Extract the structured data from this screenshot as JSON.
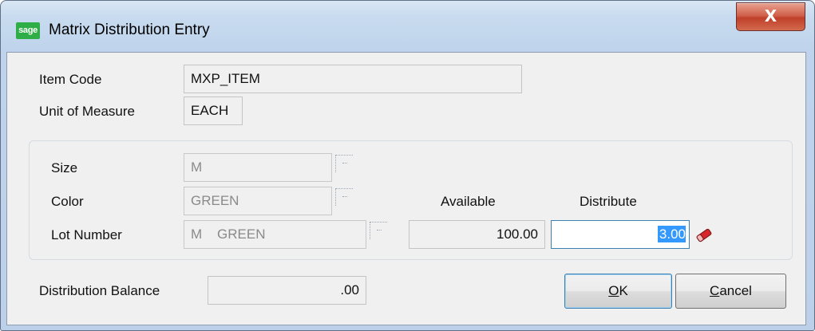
{
  "window": {
    "title": "Matrix Distribution Entry",
    "app_icon_text": "sage",
    "close_label": "X"
  },
  "header_fields": {
    "item_code": {
      "label": "Item Code",
      "value": "MXP_ITEM"
    },
    "unit_of_measure": {
      "label": "Unit of Measure",
      "value": "EACH"
    }
  },
  "matrix": {
    "size": {
      "label": "Size",
      "value": "M"
    },
    "color": {
      "label": "Color",
      "value": "GREEN"
    },
    "lot_number": {
      "label": "Lot Number",
      "value": "M    GREEN"
    },
    "available": {
      "label": "Available",
      "value": "100.00"
    },
    "distribute": {
      "label": "Distribute",
      "value": "3.00"
    }
  },
  "footer": {
    "distribution_balance": {
      "label": "Distribution Balance",
      "value": ".00"
    },
    "ok_button": {
      "mnemonic": "O",
      "rest": "K"
    },
    "cancel_button": {
      "mnemonic": "C",
      "rest": "ancel"
    }
  },
  "icons": {
    "lookup": "lookup-icon",
    "eraser": "eraser-icon"
  },
  "colors": {
    "selection": "#3399ff",
    "title_bar": "#c8dbef",
    "close_button": "#c0402a",
    "eraser": "#d4282c"
  }
}
